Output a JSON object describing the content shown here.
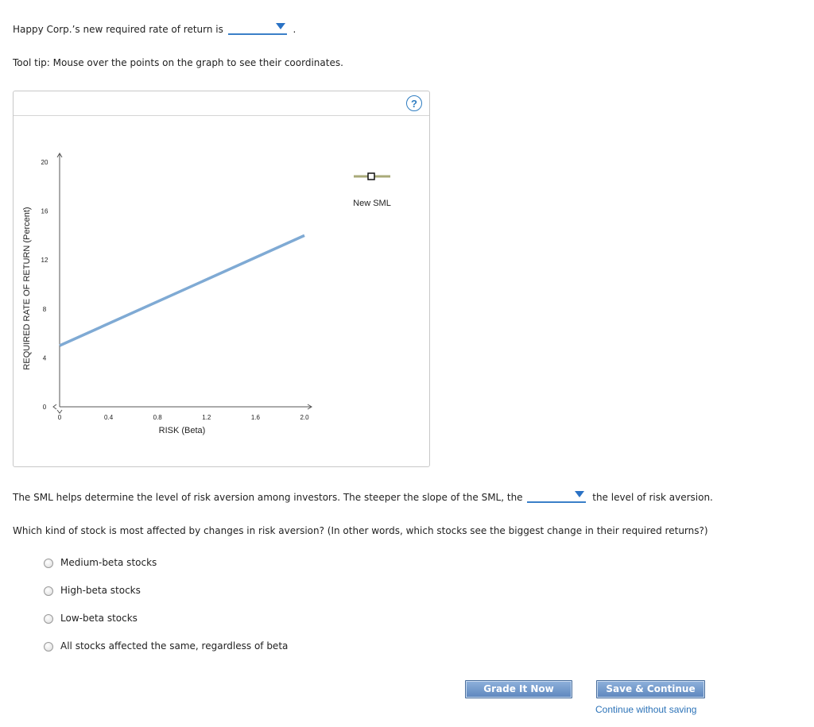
{
  "prompt1": {
    "text": "Happy Corp.’s new required rate of return is",
    "period": "."
  },
  "tooltip": "Tool tip: Mouse over the points on the graph to see their coordinates.",
  "graph": {
    "help_symbol": "?",
    "legend_label": "New SML",
    "legend_color": "#a9aa78",
    "line_color": "#7faad4"
  },
  "chart_data": {
    "type": "line",
    "xlabel": "RISK (Beta)",
    "ylabel": "REQUIRED RATE OF RETURN (Percent)",
    "xlim": [
      0,
      2.0
    ],
    "ylim": [
      0,
      20
    ],
    "x_ticks": [
      "0",
      "0.4",
      "0.8",
      "1.2",
      "1.6",
      "2.0"
    ],
    "y_ticks": [
      "0",
      "4",
      "8",
      "12",
      "16",
      "20"
    ],
    "series": [
      {
        "name": "New SML",
        "x": [
          0,
          2.0
        ],
        "y": [
          5.0,
          14.0
        ]
      }
    ]
  },
  "sml": {
    "before": "The SML helps determine the level of risk aversion among investors. The steeper the slope of the SML, the",
    "after": "the level of risk aversion."
  },
  "question": "Which kind of stock is most affected by changes in risk aversion? (In other words, which stocks see the biggest change in their required returns?)",
  "options": [
    "Medium-beta stocks",
    "High-beta stocks",
    "Low-beta stocks",
    "All stocks affected the same, regardless of beta"
  ],
  "buttons": {
    "grade": "Grade It Now",
    "save": "Save & Continue",
    "continue_link": "Continue without saving"
  }
}
